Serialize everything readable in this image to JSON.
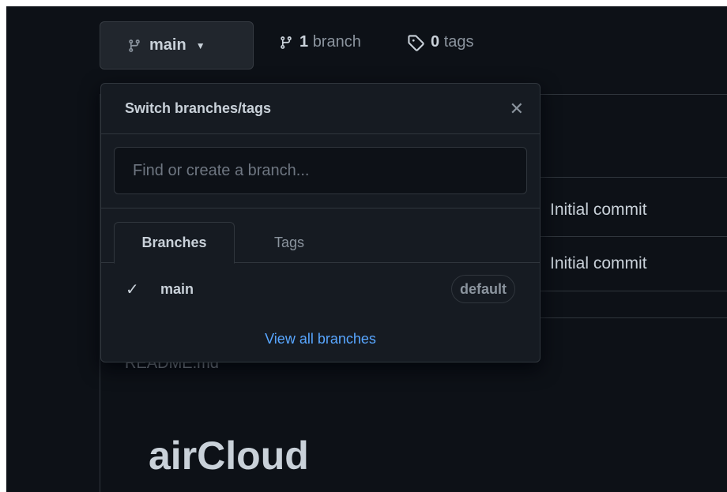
{
  "repo_nav": {
    "current_branch": "main",
    "branch_count": "1",
    "branch_label": "branch",
    "tag_count": "0",
    "tag_label": "tags"
  },
  "background": {
    "commits": [
      "Initial commit",
      "Initial commit"
    ],
    "readme_label": "README.md",
    "project_title": "airCloud"
  },
  "dropdown": {
    "title": "Switch branches/tags",
    "search_placeholder": "Find or create a branch...",
    "tabs": [
      {
        "label": "Branches",
        "active": true
      },
      {
        "label": "Tags",
        "active": false
      }
    ],
    "branches": [
      {
        "name": "main",
        "selected": true,
        "badge": "default"
      }
    ],
    "footer_link": "View all branches"
  },
  "colors": {
    "background": "#0d1117",
    "panel": "#161b22",
    "border": "#30363d",
    "link": "#58a6ff",
    "text": "#c9d1d9",
    "muted": "#8b949e"
  },
  "icons": {
    "branch": "git-branch-icon",
    "tag": "tag-icon",
    "close": "close-icon",
    "check": "check-icon",
    "caret": "caret-down-icon"
  }
}
